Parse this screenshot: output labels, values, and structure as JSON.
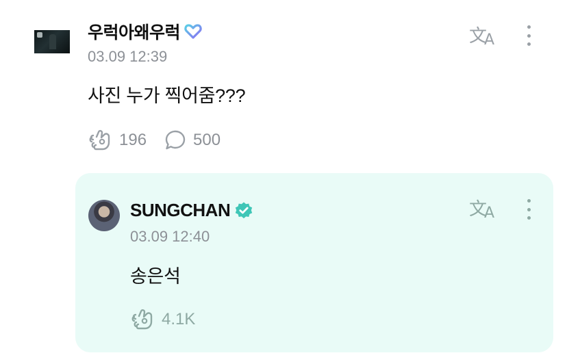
{
  "post": {
    "author": "우럭아왜우럭",
    "timestamp": "03.09 12:39",
    "text": "사진 누가 찍어줌???",
    "likes": "196",
    "comments": "500",
    "badge_color": "#8b6cf3"
  },
  "reply": {
    "author": "SUNGCHAN",
    "timestamp": "03.09 12:40",
    "text": "송은석",
    "likes": "4.1K",
    "background": "#e9fbf7",
    "verified_color": "#3fc6b7"
  },
  "icons": {
    "translate": "translate-icon",
    "more": "more-vertical-icon",
    "like": "like-icon",
    "comment": "comment-bubble-icon",
    "verified": "verified-badge-icon",
    "heart_badge": "heart-outline-badge-icon"
  }
}
